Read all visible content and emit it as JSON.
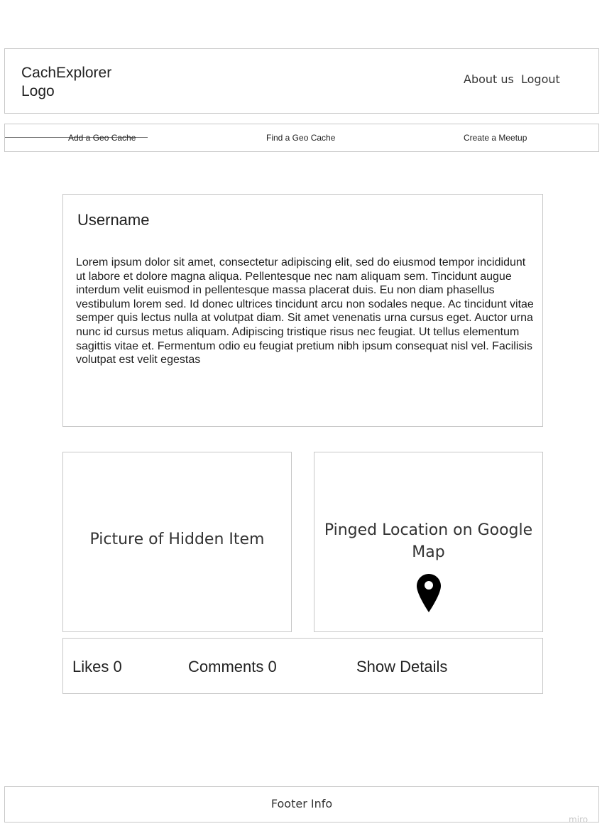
{
  "header": {
    "logo_text": "CachExplorer Logo",
    "about_label": "About us",
    "logout_label": "Logout"
  },
  "nav": {
    "items": [
      {
        "label": "Add a Geo Cache"
      },
      {
        "label": "Find a Geo Cache"
      },
      {
        "label": "Create a Meetup"
      }
    ]
  },
  "profile": {
    "username": "Username",
    "bio": "Lorem ipsum dolor sit amet, consectetur adipiscing elit, sed do eiusmod tempor incididunt ut labore et dolore magna aliqua. Pellentesque nec nam aliquam sem. Tincidunt augue interdum velit euismod in pellentesque massa placerat duis. Eu non diam phasellus vestibulum lorem sed. Id donec ultrices tincidunt arcu non sodales neque. Ac tincidunt vitae semper quis lectus nulla at volutpat diam. Sit amet venenatis urna cursus eget. Auctor urna nunc id cursus metus aliquam. Adipiscing tristique risus nec feugiat. Ut tellus elementum sagittis vitae et. Fermentum odio eu feugiat pretium nibh ipsum consequat nisl vel. Facilisis volutpat est velit egestas"
  },
  "picture": {
    "label": "Picture of Hidden Item"
  },
  "map": {
    "label": "Pinged Location on Google Map",
    "icon": "map-pin-icon"
  },
  "stats": {
    "likes": "Likes 0",
    "comments": "Comments 0",
    "show_details": "Show Details"
  },
  "footer": {
    "text": "Footer Info"
  },
  "watermark": "miro",
  "colors": {
    "border": "#c8c8c8",
    "text": "#222222",
    "pin": "#000000"
  }
}
